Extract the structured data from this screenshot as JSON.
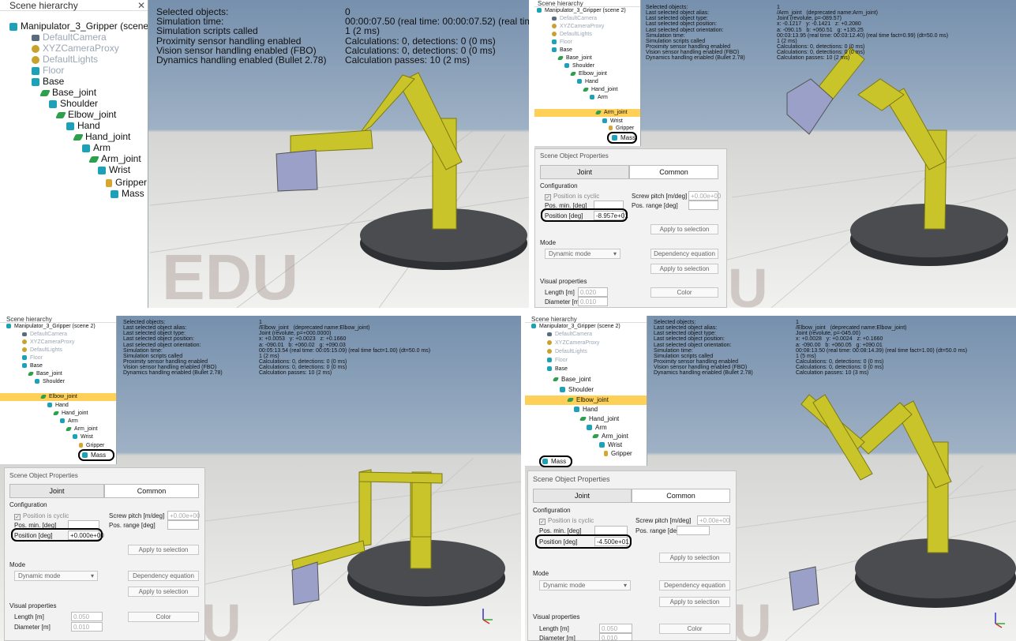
{
  "hierarchy_title": "Scene hierarchy",
  "close_glyph": "✕",
  "edu": "EDU",
  "edu_partial": "U",
  "tree": {
    "root": "Manipulator_3_Gripper (scene 2)",
    "default_camera": "DefaultCamera",
    "xyz_camera_proxy": "XYZCameraProxy",
    "default_lights": "DefaultLights",
    "floor": "Floor",
    "base": "Base",
    "base_joint": "Base_joint",
    "shoulder": "Shoulder",
    "elbow_joint": "Elbow_joint",
    "hand": "Hand",
    "hand_joint": "Hand_joint",
    "arm": "Arm",
    "arm_joint": "Arm_joint",
    "wrist": "Wrist",
    "gripper": "Gripper",
    "mass": "Mass"
  },
  "q1_info": {
    "labels": "Selected objects:\nSimulation time:\nSimulation scripts called\nProximity sensor handling enabled\nVision sensor handling enabled (FBO)\nDynamics handling enabled (Bullet 2.78)",
    "values": "0\n00:00:07.50 (real time: 00:00:07.52) (real time fact=1.\n1 (2 ms)\nCalculations: 0, detections: 0 (0 ms)\nCalculations: 0, detections: 0 (0 ms)\nCalculation passes: 10 (2 ms)"
  },
  "q2_info": {
    "labels": "Selected objects:\nLast selected object alias:\nLast selected object type:\nLast selected object position:\nLast selected object orientation:\nSimulation time:\nSimulation scripts called\nProximity sensor handling enabled\nVision sensor handling enabled (FBO)\nDynamics handling enabled (Bullet 2.78)",
    "values": "1\n/Arm_joint   (deprecated name:Arm_joint)\nJoint (revolute, p=-089.57)\nx: -0.1217   y: -0.1421   z: +0.2080\na: -090.15   b: +060.51   g: +135.25\n00:03:13.95 (real time: 00:03:12.40) (real time fact=0.99) (dt=50.0 ms)\n1 (2 ms)\nCalculations: 0, detections: 0 (0 ms)\nCalculations: 0, detections: 0 (0 ms)\nCalculation passes: 10 (2 ms)"
  },
  "q3_info": {
    "labels": "Selected objects:\nLast selected object alias:\nLast selected object type:\nLast selected object position:\nLast selected object orientation:\nSimulation time:\nSimulation scripts called\nProximity sensor handling enabled\nVision sensor handling enabled (FBO)\nDynamics handling enabled (Bullet 2.78)",
    "values": "1\n/Elbow_joint   (deprecated name:Elbow_joint)\nJoint (revolute, p=+000.0000)\nx: +0.0053   y: +0.0023   z: +0.1660\na: -090.01   b: +060.02   g: +090.03\n00:05:13.54 (real time: 00:05:15.09) (real time fact=1.00) (dt=50.0 ms)\n1 (2 ms)\nCalculations: 0, detections: 0 (0 ms)\nCalculations: 0, detections: 0 (0 ms)\nCalculation passes: 10 (2 ms)"
  },
  "q4_info": {
    "labels": "Selected objects:\nLast selected object alias:\nLast selected object type:\nLast selected object position:\nLast selected object orientation:\nSimulation time:\nSimulation scripts called\nProximity sensor handling enabled\nVision sensor handling enabled (FBO)\nDynamics handling enabled (Bullet 2.78)",
    "values": "1\n/Elbow_joint   (deprecated name:Elbow_joint)\nJoint (revolute, p=-045.00)\nx: +0.0028   y: +0.0024   z: +0.1660\na: -090.00   b: +060.05   g: +090.01\n00:08:13.50 (real time: 00:08:14.39) (real time fact=1.00) (dt=50.0 ms)\n1 (5 ms)\nCalculations: 0, detections: 0 (0 ms)\nCalculations: 0, detections: 0 (0 ms)\nCalculation passes: 10 (3 ms)"
  },
  "dialog": {
    "title": "Scene Object Properties",
    "tab_joint": "Joint",
    "tab_common": "Common",
    "configuration": "Configuration",
    "position_cyclic": "Position is cyclic",
    "screw_pitch": "Screw pitch [m/deg]",
    "screw_value": "+0.00e+00",
    "pos_min": "Pos. min. [deg]",
    "pos_range": "Pos. range [deg]",
    "position": "Position [deg]",
    "apply": "Apply to selection",
    "mode": "Mode",
    "dynamic_mode": "Dynamic mode",
    "dependency": "Dependency equation",
    "visual": "Visual properties",
    "length": "Length [m]",
    "diameter": "Diameter [m]",
    "color": "Color",
    "diameter_value": "0.010"
  },
  "q2_dialog": {
    "position_value": "-8.957e+01",
    "length_value": "0.020"
  },
  "q3_dialog": {
    "position_value": "+0.000e+00",
    "length_value": "0.050"
  },
  "q4_dialog": {
    "position_value": "-4.500e+01",
    "length_value": "0.050"
  },
  "colors": {
    "robot": "#c9c42a",
    "base": "#4a4c50",
    "cube": "#9aa0c8",
    "highlight": "#ffd057",
    "sky": "#7d93ad"
  }
}
